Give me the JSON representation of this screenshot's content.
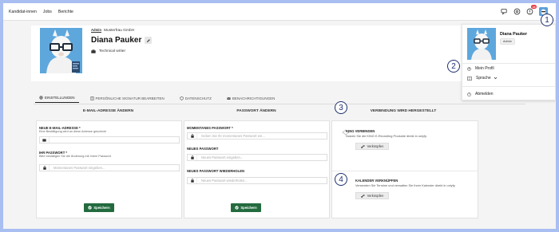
{
  "topnav": {
    "items": [
      "Kandidat-innen",
      "Jobs",
      "Berichte"
    ],
    "notification_count": "10"
  },
  "profile": {
    "admin_label": "Admin",
    "company": "Musterfrau GmbH",
    "name": "Diana Pauker",
    "job_title": "Technical writer"
  },
  "tabs": [
    {
      "label": "EINSTELLUNGEN",
      "icon": "gear-icon"
    },
    {
      "label": "PERSÖNLICHE SIGNATUR BEARBEITEN",
      "icon": "document-icon"
    },
    {
      "label": "DATENSCHUTZ",
      "icon": "shield-icon"
    },
    {
      "label": "BENACHRICHTIGUNGEN",
      "icon": "mail-icon"
    }
  ],
  "sections": {
    "email": "E-MAIL-ADRESSE ÄNDERN",
    "password": "PASSWORT ÄNDERN",
    "connection": "VERBINDUNG WIRD HERGESTELLT"
  },
  "email_form": {
    "new_email_label": "NEUE E-MAIL-ADRESSE *",
    "new_email_hint": "Eine Bestätigung wird an diese Adresse geschickt",
    "password_label": "IHR PASSWORT *",
    "password_hint": "Bitte bestätigen Sie die Änderung mit Ihrem Passwort",
    "password_placeholder": "Momentanes Passwort eingeben...",
    "save": "Speichern"
  },
  "password_form": {
    "current_label": "MOMENTANES PASSWORT *",
    "current_placeholder": "Geben Sie Ihr momentanes Passwort ein...",
    "new_label": "NEUES PASSWORT",
    "new_placeholder": "Neues Passwort eingeben...",
    "repeat_label": "NEUES PASSWORT WIEDERHOLEN",
    "repeat_placeholder": "Neues Passwort wiederholen...",
    "save": "Speichern"
  },
  "connections": {
    "king_title": "KING VERBINDEN",
    "king_desc": "Nutzen Sie die KING E-Recruiting Produkte direkt in onlyfy.",
    "king_button": "Verknüpfen",
    "calendar_title": "KALENDER VERKNÜPFEN",
    "calendar_desc": "Versenden Sie Termine und verwalten Sie Ihren Kalender direkt in onlyfy.",
    "calendar_button": "Verknüpfen"
  },
  "dropdown": {
    "name": "Diana Pauker",
    "role": "Admin",
    "items": [
      "Mein Profil",
      "Sprache",
      "Abmelden"
    ]
  },
  "markers": [
    "1",
    "2",
    "3",
    "4"
  ],
  "colors": {
    "frame": "#a9bef1",
    "save_button": "#236b3f",
    "marker": "#1d2f6f",
    "badge": "#e0343a"
  }
}
